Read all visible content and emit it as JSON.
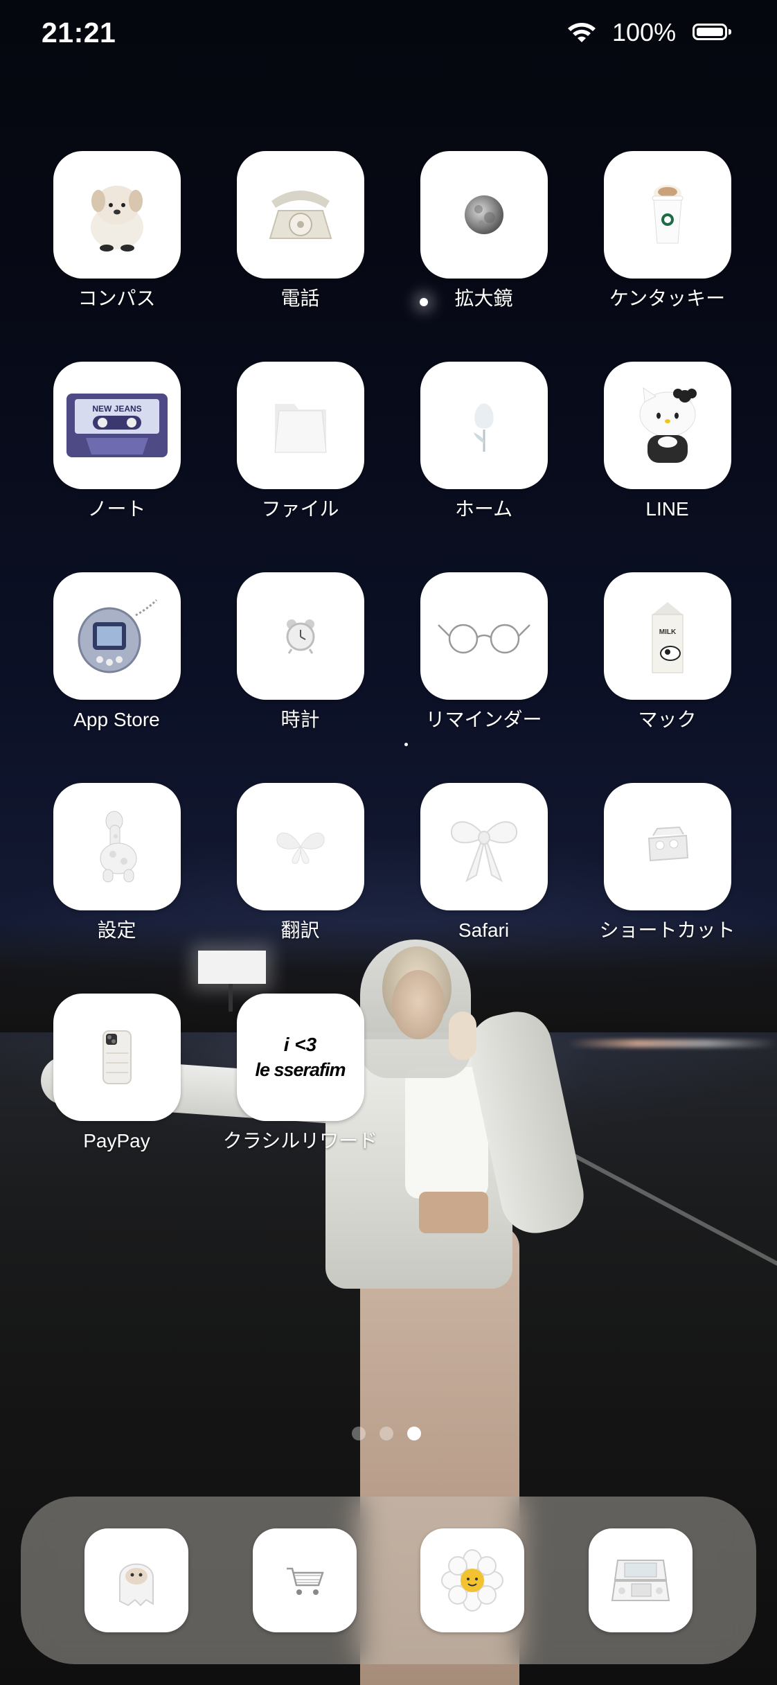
{
  "status_bar": {
    "time": "21:21",
    "battery_percent": "100%",
    "battery_level": 1.0
  },
  "apps": [
    {
      "label": "コンパス",
      "icon": "dog-plush-icon"
    },
    {
      "label": "電話",
      "icon": "rotary-phone-icon"
    },
    {
      "label": "拡大鏡",
      "icon": "moon-icon"
    },
    {
      "label": "ケンタッキー",
      "icon": "coffee-cup-icon"
    },
    {
      "label": "ノート",
      "icon": "cassette-tape-icon",
      "art_text": "NEW JEANS"
    },
    {
      "label": "ファイル",
      "icon": "folder-icon"
    },
    {
      "label": "ホーム",
      "icon": "tulip-icon"
    },
    {
      "label": "LINE",
      "icon": "hello-kitty-icon"
    },
    {
      "label": "App Store",
      "icon": "tamagotchi-icon"
    },
    {
      "label": "時計",
      "icon": "alarm-clock-icon"
    },
    {
      "label": "リマインダー",
      "icon": "glasses-icon"
    },
    {
      "label": "マック",
      "icon": "milk-carton-icon",
      "art_text": "MILK"
    },
    {
      "label": "設定",
      "icon": "giraffe-plush-icon"
    },
    {
      "label": "翻訳",
      "icon": "butterfly-icon"
    },
    {
      "label": "Safari",
      "icon": "bow-ribbon-icon"
    },
    {
      "label": "ショートカット",
      "icon": "egg-carton-icon"
    },
    {
      "label": "PayPay",
      "icon": "phone-case-icon"
    },
    {
      "label": "クラシルリワード",
      "icon": "text-sticker-icon",
      "art_line1": "i <3",
      "art_line2": "le sserafim"
    }
  ],
  "page_dots": {
    "count": 3,
    "active_index": 2
  },
  "dock": [
    {
      "icon": "ghost-plush-icon"
    },
    {
      "icon": "shopping-cart-icon"
    },
    {
      "icon": "daisy-flower-icon"
    },
    {
      "icon": "nintendo-3ds-icon"
    }
  ]
}
